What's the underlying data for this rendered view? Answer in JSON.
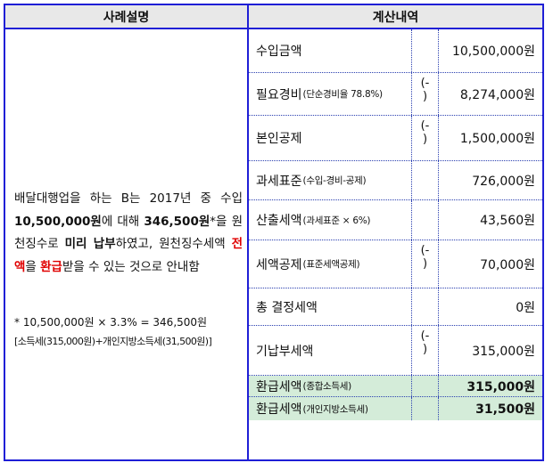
{
  "header": {
    "left": "사례설명",
    "right": "계산내역"
  },
  "description": {
    "p1": "배달대행업을 하는 B는 2017년 중 수입 ",
    "amount_income": "10,500,000원",
    "p2": "에 대해 ",
    "amount_tax": "346,500원",
    "p3": "*을 원천징수로 ",
    "bold_phrase": "미리 납부",
    "p4": "하였고, 원천징수세액 ",
    "red1": "전액",
    "p5": "을 ",
    "red2": "환급",
    "p6": "받을 수 있는 것으로 안내함",
    "note_line1": "* 10,500,000원 × 3.3% = 346,500원",
    "note_line2": "[소득세(315,000원)+개인지방소득세(31,500원)]"
  },
  "rows": [
    {
      "label": "수입금액",
      "sub": "",
      "op": "",
      "value": "10,500,000원"
    },
    {
      "label": "필요경비",
      "sub": "(단순경비율 78.8%)",
      "op": "(-)",
      "value": "8,274,000원"
    },
    {
      "label": "본인공제",
      "sub": "",
      "op": "(-)",
      "value": "1,500,000원"
    },
    {
      "label": "과세표준",
      "sub": "(수입-경비-공제)",
      "op": "",
      "value": "726,000원"
    },
    {
      "label": "산출세액",
      "sub": "(과세표준 × 6%)",
      "op": "",
      "value": "43,560원"
    },
    {
      "label": "세액공제",
      "sub": "(표준세액공제)",
      "op": "(-)",
      "value": "70,000원"
    },
    {
      "label": "총 결정세액",
      "sub": "",
      "op": "",
      "value": "0원"
    },
    {
      "label": "기납부세액",
      "sub": "",
      "op": "(-)",
      "value": "315,000원"
    },
    {
      "label": "환급세액",
      "sub": "(종합소득세)",
      "op": "",
      "value": "315,000원"
    },
    {
      "label": "환급세액",
      "sub": "(개인지방소득세)",
      "op": "",
      "value": "31,500원"
    }
  ],
  "colors": {
    "border": "#1f1fd6",
    "header_bg": "#e8e8e8",
    "refund_bg": "#d4ecd9",
    "highlight": "#e00000"
  }
}
